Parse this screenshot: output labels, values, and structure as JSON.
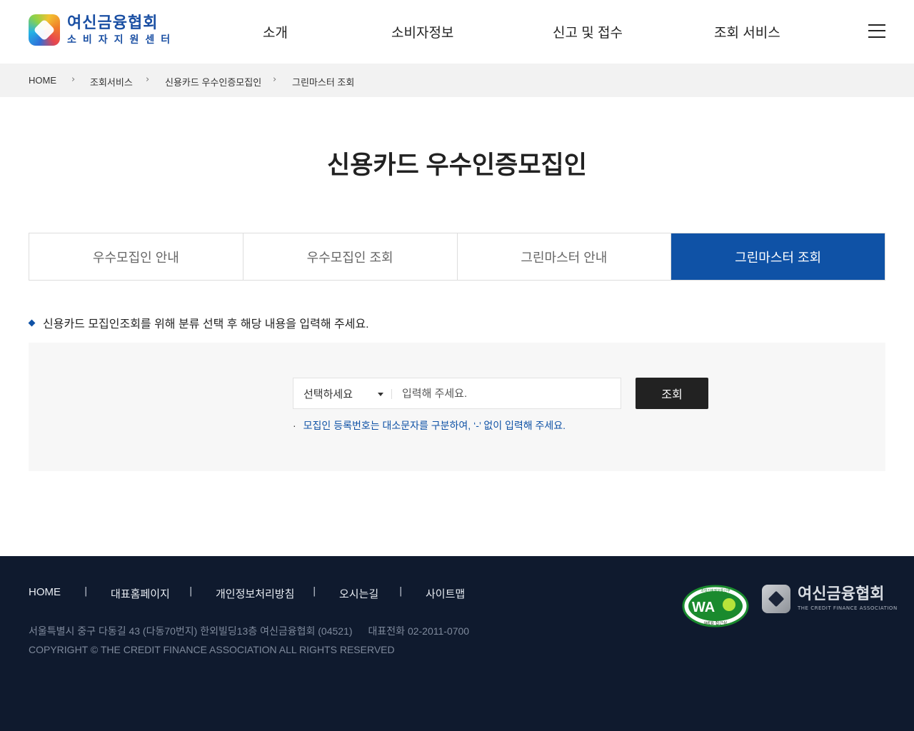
{
  "header": {
    "logo_main": "여신금융협회",
    "logo_sub": "소비자지원센터",
    "nav": [
      "소개",
      "소비자정보",
      "신고 및 접수",
      "조회 서비스"
    ]
  },
  "breadcrumb": [
    "HOME",
    "조회서비스",
    "신용카드 우수인증모집인",
    "그린마스터 조회"
  ],
  "page_title": "신용카드 우수인증모집인",
  "tabs": [
    "우수모집인 안내",
    "우수모집인 조회",
    "그린마스터 안내",
    "그린마스터 조회"
  ],
  "active_tab": "그린마스터 조회",
  "instruction": "신용카드 모집인조회를 위해 분류 선택 후 해당 내용을 입력해 주세요.",
  "search": {
    "select_value": "선택하세요",
    "input_placeholder": "입력해 주세요.",
    "button_label": "조회",
    "hint": "모집인 등록번호는 대소문자를 구분하여, ‘-’ 없이 입력해 주세요."
  },
  "footer": {
    "links": [
      "HOME",
      "대표홈페이지",
      "개인정보처리방침",
      "오시는길",
      "사이트맵"
    ],
    "address": "서울특별시 중구 다동길 43 (다동70번지) 한외빌딩13층 여신금융협회 (04521)",
    "phone": "대표전화 02-2011-0700",
    "copyright": "COPYRIGHT © THE CREDIT FINANCE ASSOCIATION ALL RIGHTS RESERVED",
    "wa_mark": {
      "text": "WA",
      "caption": "WEB 접근성",
      "org": "과학기술정보통신부"
    },
    "cfa_logo_main": "여신금융협회",
    "cfa_logo_sub": "THE CREDIT FINANCE ASSOCIATION"
  },
  "colors": {
    "brand_blue": "#0f52a6",
    "footer_bg": "#0f1a2e",
    "button_dark": "#222222"
  }
}
